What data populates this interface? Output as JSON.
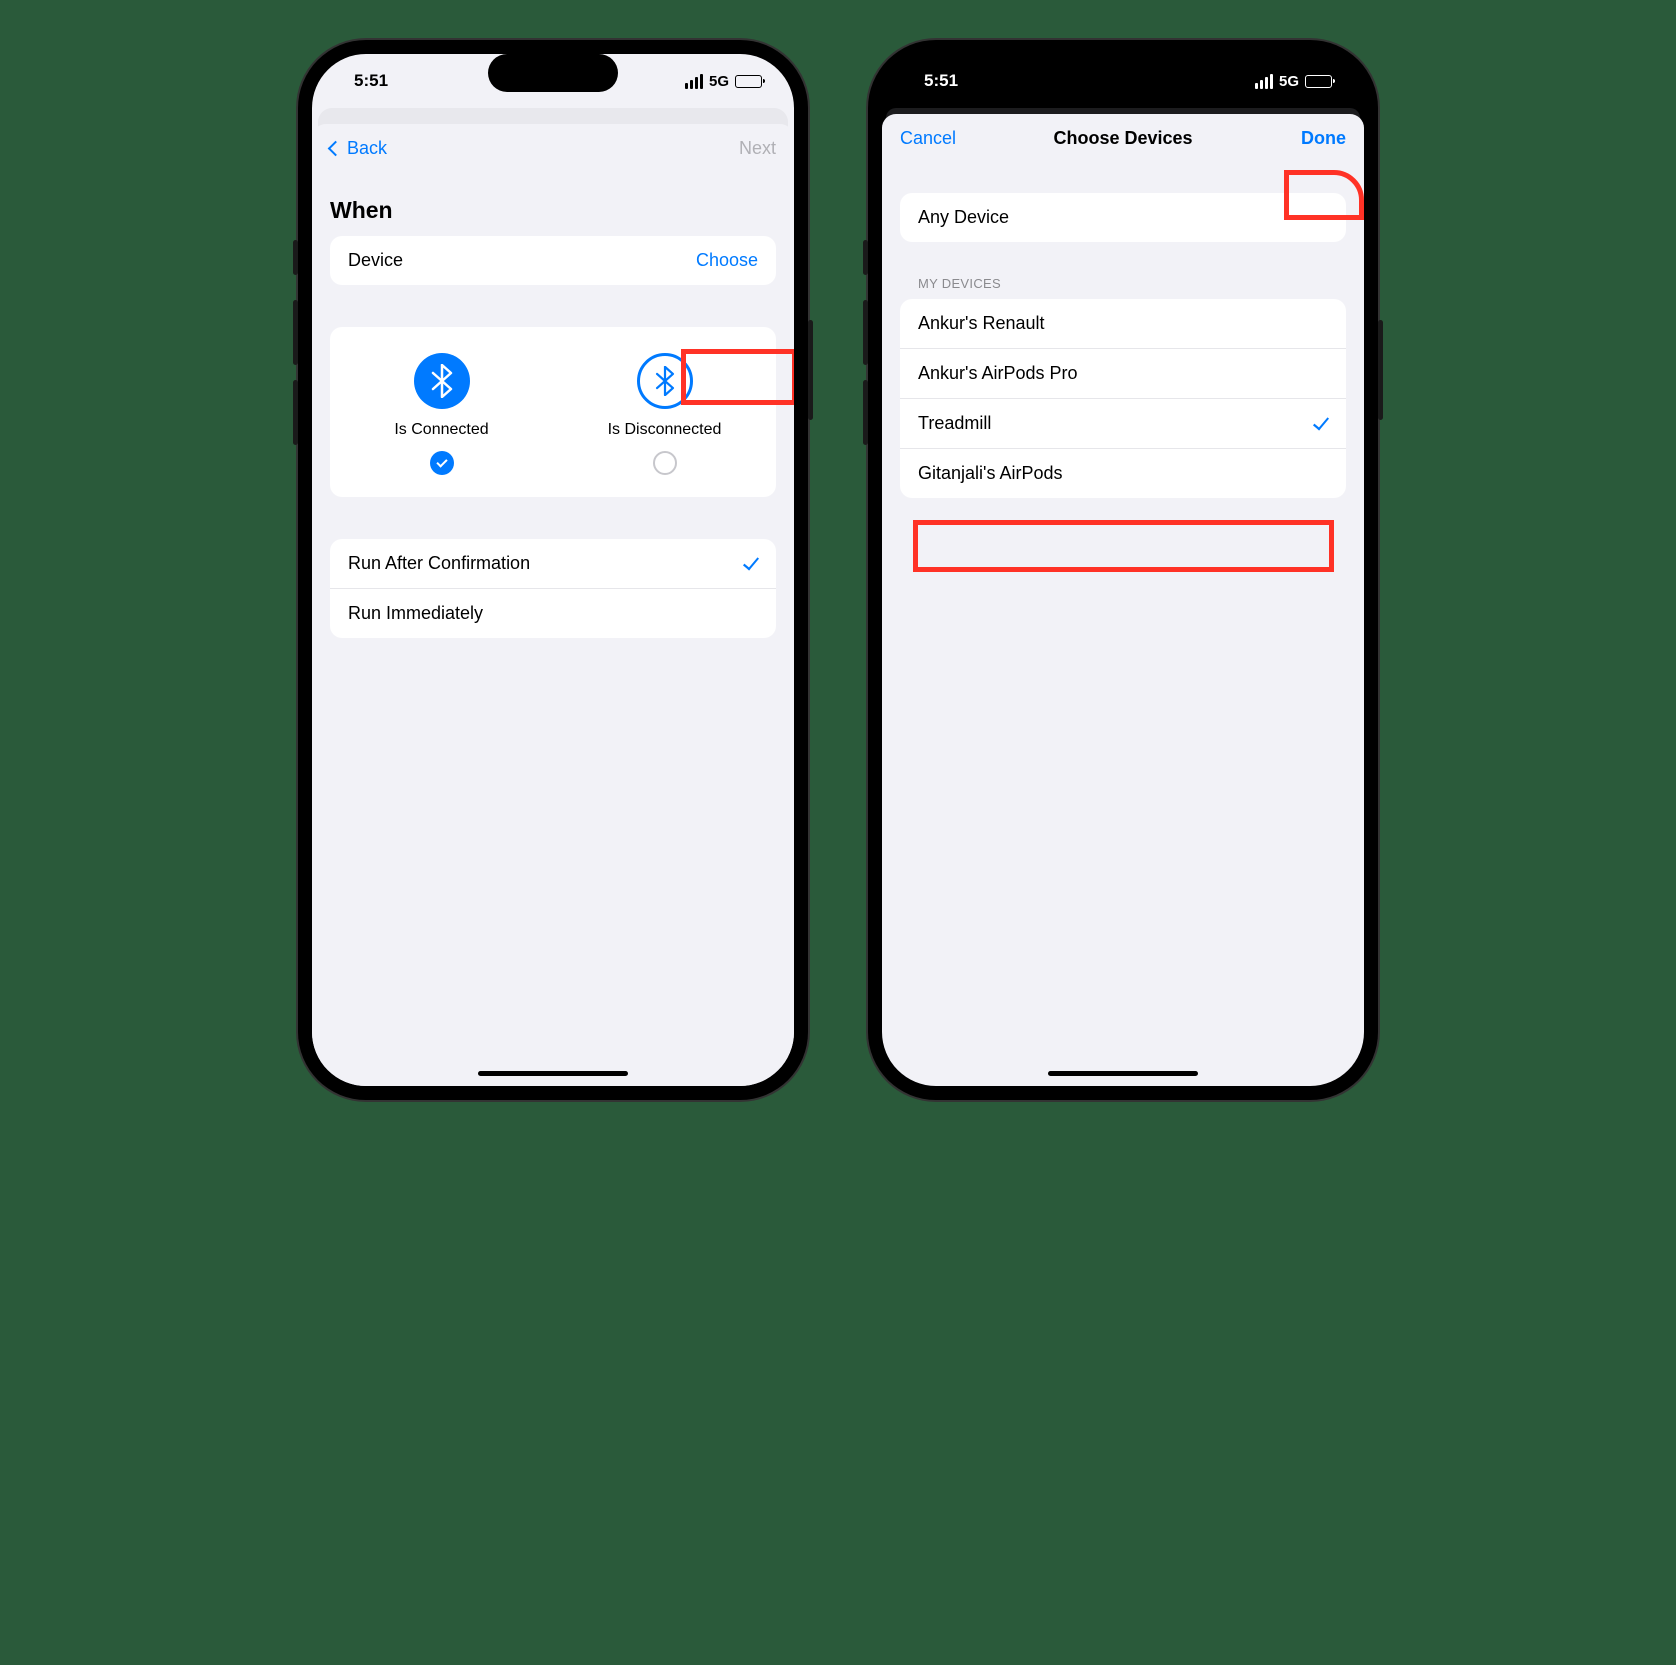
{
  "status": {
    "time": "5:51",
    "network": "5G"
  },
  "left": {
    "nav": {
      "back": "Back",
      "next": "Next"
    },
    "section_header": "When",
    "device_row": {
      "label": "Device",
      "action": "Choose"
    },
    "options": {
      "connected": {
        "label": "Is Connected",
        "selected": true
      },
      "disconnected": {
        "label": "Is Disconnected",
        "selected": false
      }
    },
    "run": {
      "after": "Run After Confirmation",
      "immediately": "Run Immediately",
      "selected": "after"
    }
  },
  "right": {
    "nav": {
      "cancel": "Cancel",
      "title": "Choose Devices",
      "done": "Done"
    },
    "any": "Any Device",
    "list_header": "MY DEVICES",
    "devices": [
      {
        "name": "Ankur's Renault",
        "selected": false
      },
      {
        "name": "Ankur's AirPods Pro",
        "selected": false
      },
      {
        "name": "Treadmill",
        "selected": true
      },
      {
        "name": "Gitanjali's AirPods",
        "selected": false
      }
    ]
  }
}
